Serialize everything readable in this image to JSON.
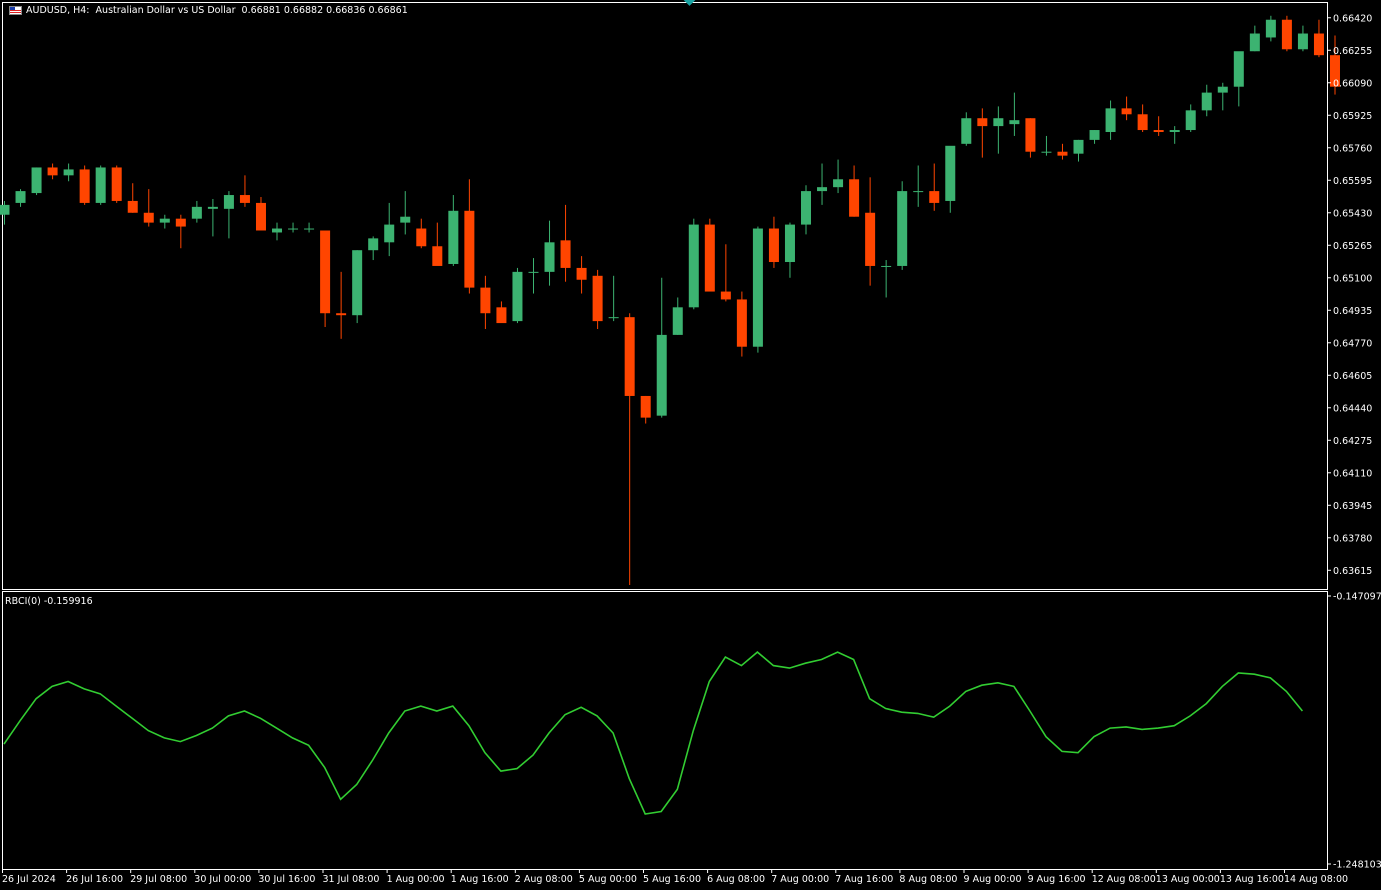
{
  "header": {
    "symbol": "AUDUSD, H4:",
    "description": "Australian Dollar vs US Dollar",
    "ohlc": "0.66881 0.66882 0.66836 0.66861"
  },
  "indicator": {
    "name": "RBCI(0)",
    "value": "-0.159916",
    "axis_labels": [
      "-0.147097",
      "-1.248103"
    ]
  },
  "colors": {
    "background": "#000000",
    "bull": "#3cb371",
    "bear": "#ff4500",
    "indicator_line": "#32cd32",
    "axis": "#ffffff"
  },
  "price_axis_labels": [
    "0.66420",
    "0.66255",
    "0.66090",
    "0.65925",
    "0.65760",
    "0.65595",
    "0.65430",
    "0.65265",
    "0.65100",
    "0.64935",
    "0.64770",
    "0.64605",
    "0.64440",
    "0.64275",
    "0.64110",
    "0.63945",
    "0.63780",
    "0.63615"
  ],
  "time_axis_labels": [
    "26 Jul 2024",
    "26 Jul 16:00",
    "29 Jul 08:00",
    "30 Jul 00:00",
    "30 Jul 16:00",
    "31 Jul 08:00",
    "1 Aug 00:00",
    "1 Aug 16:00",
    "2 Aug 08:00",
    "5 Aug 00:00",
    "5 Aug 16:00",
    "6 Aug 08:00",
    "7 Aug 00:00",
    "7 Aug 16:00",
    "8 Aug 08:00",
    "9 Aug 00:00",
    "9 Aug 16:00",
    "12 Aug 08:00",
    "13 Aug 00:00",
    "13 Aug 16:00",
    "14 Aug 08:00"
  ],
  "chart_data": [
    {
      "type": "candlestick",
      "title": "AUDUSD, H4: Australian Dollar vs US Dollar",
      "ylim": [
        0.6352,
        0.665
      ],
      "candles": [
        [
          0.6542,
          0.6549,
          0.6537,
          0.6547
        ],
        [
          0.6548,
          0.6555,
          0.6546,
          0.6554
        ],
        [
          0.6553,
          0.6566,
          0.6552,
          0.6566
        ],
        [
          0.6566,
          0.6568,
          0.656,
          0.6562
        ],
        [
          0.6562,
          0.6568,
          0.6559,
          0.6565
        ],
        [
          0.6565,
          0.6567,
          0.6547,
          0.6548
        ],
        [
          0.6548,
          0.6567,
          0.6547,
          0.6566
        ],
        [
          0.6566,
          0.6567,
          0.6548,
          0.6549
        ],
        [
          0.6549,
          0.6558,
          0.6543,
          0.6543
        ],
        [
          0.6543,
          0.6555,
          0.6536,
          0.6538
        ],
        [
          0.6538,
          0.6542,
          0.6535,
          0.654
        ],
        [
          0.654,
          0.6542,
          0.6525,
          0.6536
        ],
        [
          0.654,
          0.6549,
          0.6538,
          0.6546
        ],
        [
          0.6545,
          0.655,
          0.6531,
          0.6546
        ],
        [
          0.6545,
          0.6554,
          0.653,
          0.6552
        ],
        [
          0.6552,
          0.6562,
          0.6546,
          0.6548
        ],
        [
          0.6548,
          0.6551,
          0.6534,
          0.6534
        ],
        [
          0.6533,
          0.6538,
          0.6529,
          0.6535
        ],
        [
          0.6535,
          0.6538,
          0.6533,
          0.6535
        ],
        [
          0.6535,
          0.6538,
          0.6533,
          0.6535
        ],
        [
          0.6534,
          0.6534,
          0.6485,
          0.6492
        ],
        [
          0.6492,
          0.6513,
          0.6479,
          0.6491
        ],
        [
          0.6491,
          0.6524,
          0.6487,
          0.6524
        ],
        [
          0.6524,
          0.6531,
          0.6519,
          0.653
        ],
        [
          0.6528,
          0.6548,
          0.6521,
          0.6537
        ],
        [
          0.6538,
          0.6554,
          0.6532,
          0.6541
        ],
        [
          0.6535,
          0.654,
          0.6525,
          0.6526
        ],
        [
          0.6526,
          0.6538,
          0.6519,
          0.6516
        ],
        [
          0.6517,
          0.6552,
          0.6516,
          0.6544
        ],
        [
          0.6544,
          0.656,
          0.6502,
          0.6505
        ],
        [
          0.6505,
          0.6511,
          0.6484,
          0.6492
        ],
        [
          0.6495,
          0.6498,
          0.6488,
          0.6487
        ],
        [
          0.6488,
          0.6515,
          0.6487,
          0.6513
        ],
        [
          0.6513,
          0.652,
          0.6502,
          0.6513
        ],
        [
          0.6513,
          0.6539,
          0.6506,
          0.6528
        ],
        [
          0.6529,
          0.6547,
          0.6508,
          0.6515
        ],
        [
          0.6515,
          0.6521,
          0.6502,
          0.6509
        ],
        [
          0.6511,
          0.6514,
          0.6484,
          0.6488
        ],
        [
          0.649,
          0.6511,
          0.6488,
          0.649
        ],
        [
          0.649,
          0.6492,
          0.6354,
          0.645
        ],
        [
          0.645,
          0.645,
          0.6436,
          0.6439
        ],
        [
          0.644,
          0.651,
          0.6439,
          0.6481
        ],
        [
          0.6481,
          0.65,
          0.6481,
          0.6495
        ],
        [
          0.6495,
          0.654,
          0.6494,
          0.6537
        ],
        [
          0.6537,
          0.654,
          0.6512,
          0.6503
        ],
        [
          0.6503,
          0.6527,
          0.6498,
          0.6499
        ],
        [
          0.6499,
          0.6503,
          0.647,
          0.6475
        ],
        [
          0.6475,
          0.6536,
          0.6472,
          0.6535
        ],
        [
          0.6535,
          0.6541,
          0.6515,
          0.6518
        ],
        [
          0.6518,
          0.6538,
          0.651,
          0.6537
        ],
        [
          0.6537,
          0.6557,
          0.6532,
          0.6554
        ],
        [
          0.6554,
          0.6568,
          0.6547,
          0.6556
        ],
        [
          0.6556,
          0.657,
          0.6553,
          0.656
        ],
        [
          0.656,
          0.6567,
          0.6541,
          0.6541
        ],
        [
          0.6543,
          0.6561,
          0.6506,
          0.6516
        ],
        [
          0.6516,
          0.6519,
          0.65,
          0.6516
        ],
        [
          0.6516,
          0.6559,
          0.6514,
          0.6554
        ],
        [
          0.6554,
          0.6567,
          0.6546,
          0.6554
        ],
        [
          0.6554,
          0.6568,
          0.6544,
          0.6548
        ],
        [
          0.6549,
          0.6559,
          0.6543,
          0.6577
        ],
        [
          0.6578,
          0.6594,
          0.6577,
          0.6591
        ],
        [
          0.6591,
          0.6596,
          0.6571,
          0.6587
        ],
        [
          0.6587,
          0.6597,
          0.6573,
          0.6591
        ],
        [
          0.6588,
          0.6604,
          0.6582,
          0.659
        ],
        [
          0.6591,
          0.6591,
          0.6571,
          0.6574
        ],
        [
          0.6574,
          0.6582,
          0.6572,
          0.6574
        ],
        [
          0.6574,
          0.6578,
          0.657,
          0.6572
        ],
        [
          0.6573,
          0.658,
          0.6569,
          0.658
        ],
        [
          0.658,
          0.6585,
          0.6578,
          0.6585
        ],
        [
          0.6584,
          0.66,
          0.658,
          0.6596
        ],
        [
          0.6596,
          0.6602,
          0.659,
          0.6593
        ],
        [
          0.6593,
          0.6598,
          0.6584,
          0.6585
        ],
        [
          0.6585,
          0.6592,
          0.6582,
          0.6584
        ],
        [
          0.6584,
          0.6587,
          0.6578,
          0.6585
        ],
        [
          0.6585,
          0.6598,
          0.6584,
          0.6595
        ],
        [
          0.6595,
          0.6608,
          0.6592,
          0.6604
        ],
        [
          0.6604,
          0.6609,
          0.6595,
          0.6607
        ],
        [
          0.6607,
          0.6623,
          0.6597,
          0.6625
        ],
        [
          0.6625,
          0.6638,
          0.6625,
          0.6634
        ],
        [
          0.6632,
          0.6643,
          0.663,
          0.6641
        ],
        [
          0.6641,
          0.6643,
          0.6625,
          0.6626
        ],
        [
          0.6626,
          0.6638,
          0.6625,
          0.6634
        ],
        [
          0.6634,
          0.6641,
          0.6622,
          0.6623
        ],
        [
          0.6623,
          0.6633,
          0.6603,
          0.6607
        ]
      ]
    },
    {
      "type": "line",
      "title": "RBCI(0) -0.159916",
      "ylim": [
        -1.248103,
        -0.147097
      ],
      "series": [
        {
          "values": [
            -0.755,
            -0.66,
            -0.57,
            -0.52,
            -0.5,
            -0.53,
            -0.55,
            -0.6,
            -0.65,
            -0.7,
            -0.73,
            -0.745,
            -0.72,
            -0.69,
            -0.64,
            -0.62,
            -0.65,
            -0.69,
            -0.73,
            -0.76,
            -0.85,
            -0.98,
            -0.92,
            -0.82,
            -0.71,
            -0.62,
            -0.6,
            -0.62,
            -0.6,
            -0.68,
            -0.79,
            -0.865,
            -0.855,
            -0.8,
            -0.71,
            -0.635,
            -0.605,
            -0.64,
            -0.71,
            -0.895,
            -1.04,
            -1.03,
            -0.94,
            -0.7,
            -0.5,
            -0.4,
            -0.435,
            -0.38,
            -0.435,
            -0.445,
            -0.425,
            -0.41,
            -0.38,
            -0.41,
            -0.57,
            -0.61,
            -0.625,
            -0.63,
            -0.645,
            -0.6,
            -0.54,
            -0.515,
            -0.505,
            -0.52,
            -0.62,
            -0.725,
            -0.785,
            -0.79,
            -0.725,
            -0.69,
            -0.685,
            -0.695,
            -0.69,
            -0.68,
            -0.64,
            -0.59,
            -0.52,
            -0.465,
            -0.47,
            -0.485,
            -0.54,
            -0.62
          ]
        }
      ]
    }
  ]
}
